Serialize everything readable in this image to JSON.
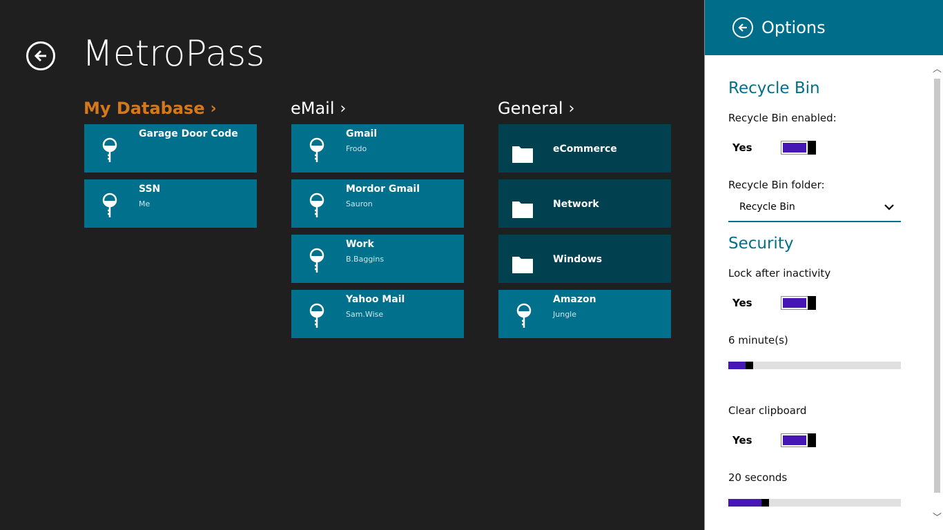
{
  "app": {
    "title": "MetroPass"
  },
  "groups": [
    {
      "header": "My Database",
      "tiles": [
        {
          "title": "Garage Door Code",
          "subtitle": ""
        },
        {
          "title": "SSN",
          "subtitle": "Me"
        }
      ]
    },
    {
      "header": "eMail",
      "tiles": [
        {
          "title": "Gmail",
          "subtitle": "Frodo"
        },
        {
          "title": "Mordor Gmail",
          "subtitle": "Sauron"
        },
        {
          "title": "Work",
          "subtitle": "B.Baggins"
        },
        {
          "title": "Yahoo Mail",
          "subtitle": "Sam.Wise"
        }
      ]
    },
    {
      "header": "General",
      "tiles": [
        {
          "title": "eCommerce"
        },
        {
          "title": "Network"
        },
        {
          "title": "Windows"
        },
        {
          "title": "Amazon",
          "subtitle": "Jungle"
        }
      ]
    }
  ],
  "options": {
    "title": "Options",
    "recycle_bin": {
      "section_title": "Recycle Bin",
      "enabled_label": "Recycle Bin enabled:",
      "enabled_value": "Yes",
      "folder_label": "Recycle Bin folder:",
      "folder_value": "Recycle Bin"
    },
    "security": {
      "section_title": "Security",
      "lock_label": "Lock after inactivity",
      "lock_value": "Yes",
      "lock_minutes_label": "6 minute(s)",
      "lock_minutes_fraction": 0.1,
      "clipboard_label": "Clear clipboard",
      "clipboard_value": "Yes",
      "clipboard_seconds_label": "20 seconds",
      "clipboard_seconds_fraction": 0.19
    }
  },
  "colors": {
    "accent": "#d4781c",
    "tile_entry": "#00708c",
    "tile_folder": "#00404f",
    "toggle": "#4617b4"
  }
}
